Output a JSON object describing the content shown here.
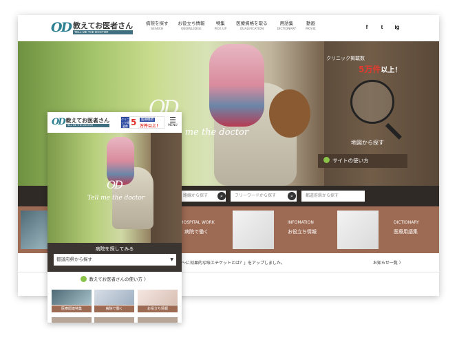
{
  "desktop": {
    "logo": {
      "mark": "OD",
      "title": "教えてお医者さん",
      "subtitle": "TELL ME THE DOCTOR"
    },
    "nav": [
      {
        "jp": "病院を探す",
        "en": "SEARCH"
      },
      {
        "jp": "お役立ち情報",
        "en": "KNOWLEDGE"
      },
      {
        "jp": "特集",
        "en": "PICK UP"
      },
      {
        "jp": "医療資格を取る",
        "en": "QUALIFICATION"
      },
      {
        "jp": "用語集",
        "en": "DICTIONARY"
      },
      {
        "jp": "動画",
        "en": "MOVIE"
      }
    ],
    "social": [
      "f",
      "t",
      "ig"
    ],
    "hero": {
      "clinic_line": "クリニック掲載数",
      "count": "5万件",
      "count_suffix": "以上！",
      "map_label": "地図から探す",
      "howto": "サイトの使い方",
      "logo_mark": "OD",
      "tagline": "Tell me the doctor"
    },
    "search": {
      "field1": "駅・路線から探す",
      "field2": "フリーワードから探す",
      "field3": "都道府県から探す"
    },
    "categories": [
      {
        "en": "HOSPITAL WORK",
        "jp": "病院で働く"
      },
      {
        "en": "INFOMATION",
        "jp": "お役立ち情報"
      },
      {
        "en": "DICTIONARY",
        "jp": "医療用語集"
      }
    ],
    "news": {
      "text": "「〜に効果的な咳エチケットとは？」をアップしました。",
      "more": "お知らせ一覧 〉"
    }
  },
  "mobile": {
    "logo": {
      "mark": "OD",
      "title": "教えてお医者さん",
      "subtitle": "TELL ME THE DOCTOR"
    },
    "badge": {
      "label": "クリニック掲載数",
      "num": "5",
      "tag": "医療機関",
      "sub": "万件以上！"
    },
    "menu_label": "MENU",
    "hero": {
      "logo_mark": "OD",
      "tagline": "Tell me the doctor"
    },
    "search": {
      "title": "病院を探してみる",
      "select": "都道府県から探す"
    },
    "howto": "教えてお医者さんの使い方 〉",
    "tiles": [
      "医療関連特集",
      "病院で働く",
      "お役立ち情報"
    ]
  }
}
